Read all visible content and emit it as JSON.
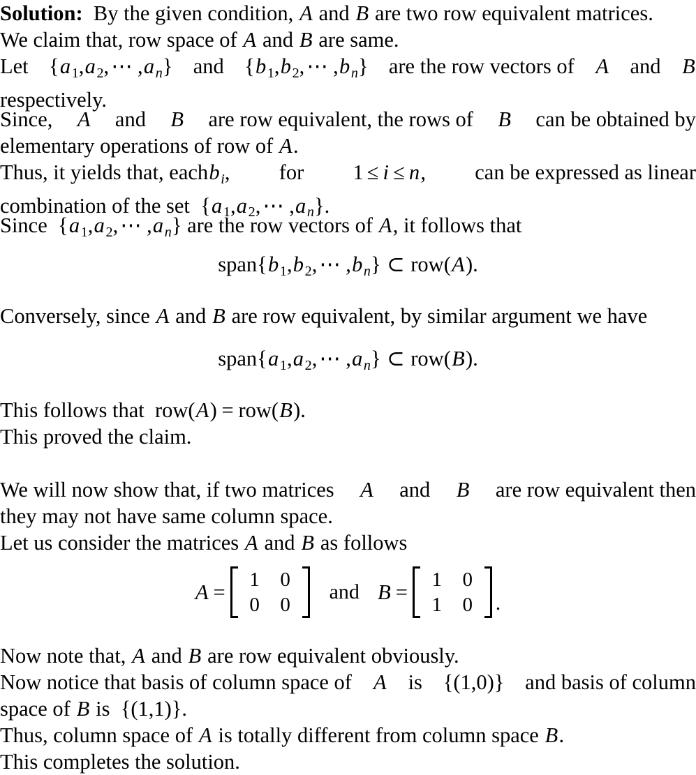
{
  "document": {
    "type": "math-solution",
    "heading_label": "Solution",
    "heading_colon": ":",
    "background_color": "#ffffff",
    "text_color": "#000000"
  },
  "paragraphs": {
    "p1": {
      "l1_a": "By the given condition,",
      "l1_A": "A",
      "l1_b": "and",
      "l1_B": "B",
      "l1_c": "are two row equivalent matrices."
    },
    "p2": {
      "a": "We claim that, row space of",
      "A": "A",
      "b": "and",
      "B": "B",
      "c": "are same."
    },
    "p3": {
      "let": "Let",
      "set_a_open": "{",
      "a1": "a",
      "a1_sub": "1",
      "comma1": ",",
      "a2": "a",
      "a2_sub": "2",
      "comma2": ",",
      "dots": "⋯",
      "comma3": ",",
      "an": "a",
      "an_sub": "n",
      "set_a_close": "}",
      "and": "and",
      "set_b_open": "{",
      "b1": "b",
      "b1_sub": "1",
      "b2": "b",
      "b2_sub": "2",
      "bn": "b",
      "bn_sub": "n",
      "set_b_close": "}",
      "tail": "are the row vectors of",
      "A": "A",
      "and2": "and",
      "B": "B",
      "line2": "respectively."
    },
    "p4": {
      "since": "Since,",
      "A": "A",
      "and": "and",
      "B": "B",
      "mid": "are row equivalent, the rows of",
      "B2": "B",
      "tail": "can be obtained by",
      "line2a": "elementary operations of row of",
      "line2A": "A",
      "line2b": "."
    },
    "p5": {
      "head": "Thus, it yields that, each",
      "b": "b",
      "b_sub": "i",
      "comma": ",",
      "for": "for",
      "one": "1",
      "le1": "≤",
      "i": "i",
      "le2": "≤",
      "n": "n",
      "comma2": ",",
      "tail": "can be expressed as linear",
      "line2": "combination of the set",
      "set_open": "{",
      "a1": "a",
      "a1_sub": "1",
      "a2": "a",
      "a2_sub": "2",
      "dots": "⋯",
      "an": "a",
      "an_sub": "n",
      "set_close": "}",
      "period": "."
    },
    "p6": {
      "since": "Since",
      "set_open": "{",
      "a1": "a",
      "a1_sub": "1",
      "a2": "a",
      "a2_sub": "2",
      "dots": "⋯",
      "an": "a",
      "an_sub": "n",
      "set_close": "}",
      "mid": "are the row vectors of",
      "A": "A",
      "tail": ", it follows that"
    },
    "p7": {
      "head": "Conversely, since",
      "A": "A",
      "and": "and",
      "B": "B",
      "tail": "are row equivalent, by similar argument we have"
    },
    "p8": {
      "head": "This follows that",
      "row1": "row",
      "A": "A",
      "eq": "=",
      "row2": "row",
      "B": "B",
      "period": "."
    },
    "p9": {
      "text": "This proved the claim."
    },
    "p10": {
      "head": "We will now show that, if two matrices",
      "A": "A",
      "and": "and",
      "B": "B",
      "tail": "are row equivalent then",
      "line2": "they may not have same column space."
    },
    "p11": {
      "head": "Let us consider the matrices",
      "A": "A",
      "and": "and",
      "B": "B",
      "tail": "as follows"
    },
    "p12": {
      "head": "Now note that,",
      "A": "A",
      "and": "and",
      "B": "B",
      "tail": "are row equivalent obviously."
    },
    "p13": {
      "head": "Now notice that basis of column space of",
      "A": "A",
      "is1": "is",
      "setA": "{(1,0)}",
      "mid": "and basis of column",
      "line2head": "space of",
      "B": "B",
      "is2": "is",
      "setB": "{(1,1)}",
      "period": "."
    },
    "p14": {
      "head": "Thus, column space of",
      "A": "A",
      "mid": "is totally different from column space",
      "B": "B",
      "period": "."
    },
    "p15": {
      "text": "This completes the solution."
    }
  },
  "equations": {
    "eq1": {
      "span": "span",
      "open": "{",
      "b1": "b",
      "b1_sub": "1",
      "comma1": ",",
      "b2": "b",
      "b2_sub": "2",
      "comma2": ",",
      "dots": "⋯",
      "comma3": ",",
      "bn": "b",
      "bn_sub": "n",
      "close": "}",
      "subset": "⊂",
      "row": "row",
      "paren_open": "(",
      "arg": "A",
      "paren_close": ")",
      "period": "."
    },
    "eq2": {
      "span": "span",
      "open": "{",
      "a1": "a",
      "a1_sub": "1",
      "comma1": ",",
      "a2": "a",
      "a2_sub": "2",
      "comma2": ",",
      "dots": "⋯",
      "comma3": ",",
      "an": "a",
      "an_sub": "n",
      "close": "}",
      "subset": "⊂",
      "row": "row",
      "paren_open": "(",
      "arg": "B",
      "paren_close": ")",
      "period": "."
    },
    "matrix_eq": {
      "A_label": "A",
      "equals1": "=",
      "matrixA": [
        [
          "1",
          "0"
        ],
        [
          "0",
          "0"
        ]
      ],
      "and": "and",
      "B_label": "B",
      "equals2": "=",
      "matrixB": [
        [
          "1",
          "0"
        ],
        [
          "1",
          "0"
        ]
      ],
      "trailing_period": "."
    }
  }
}
